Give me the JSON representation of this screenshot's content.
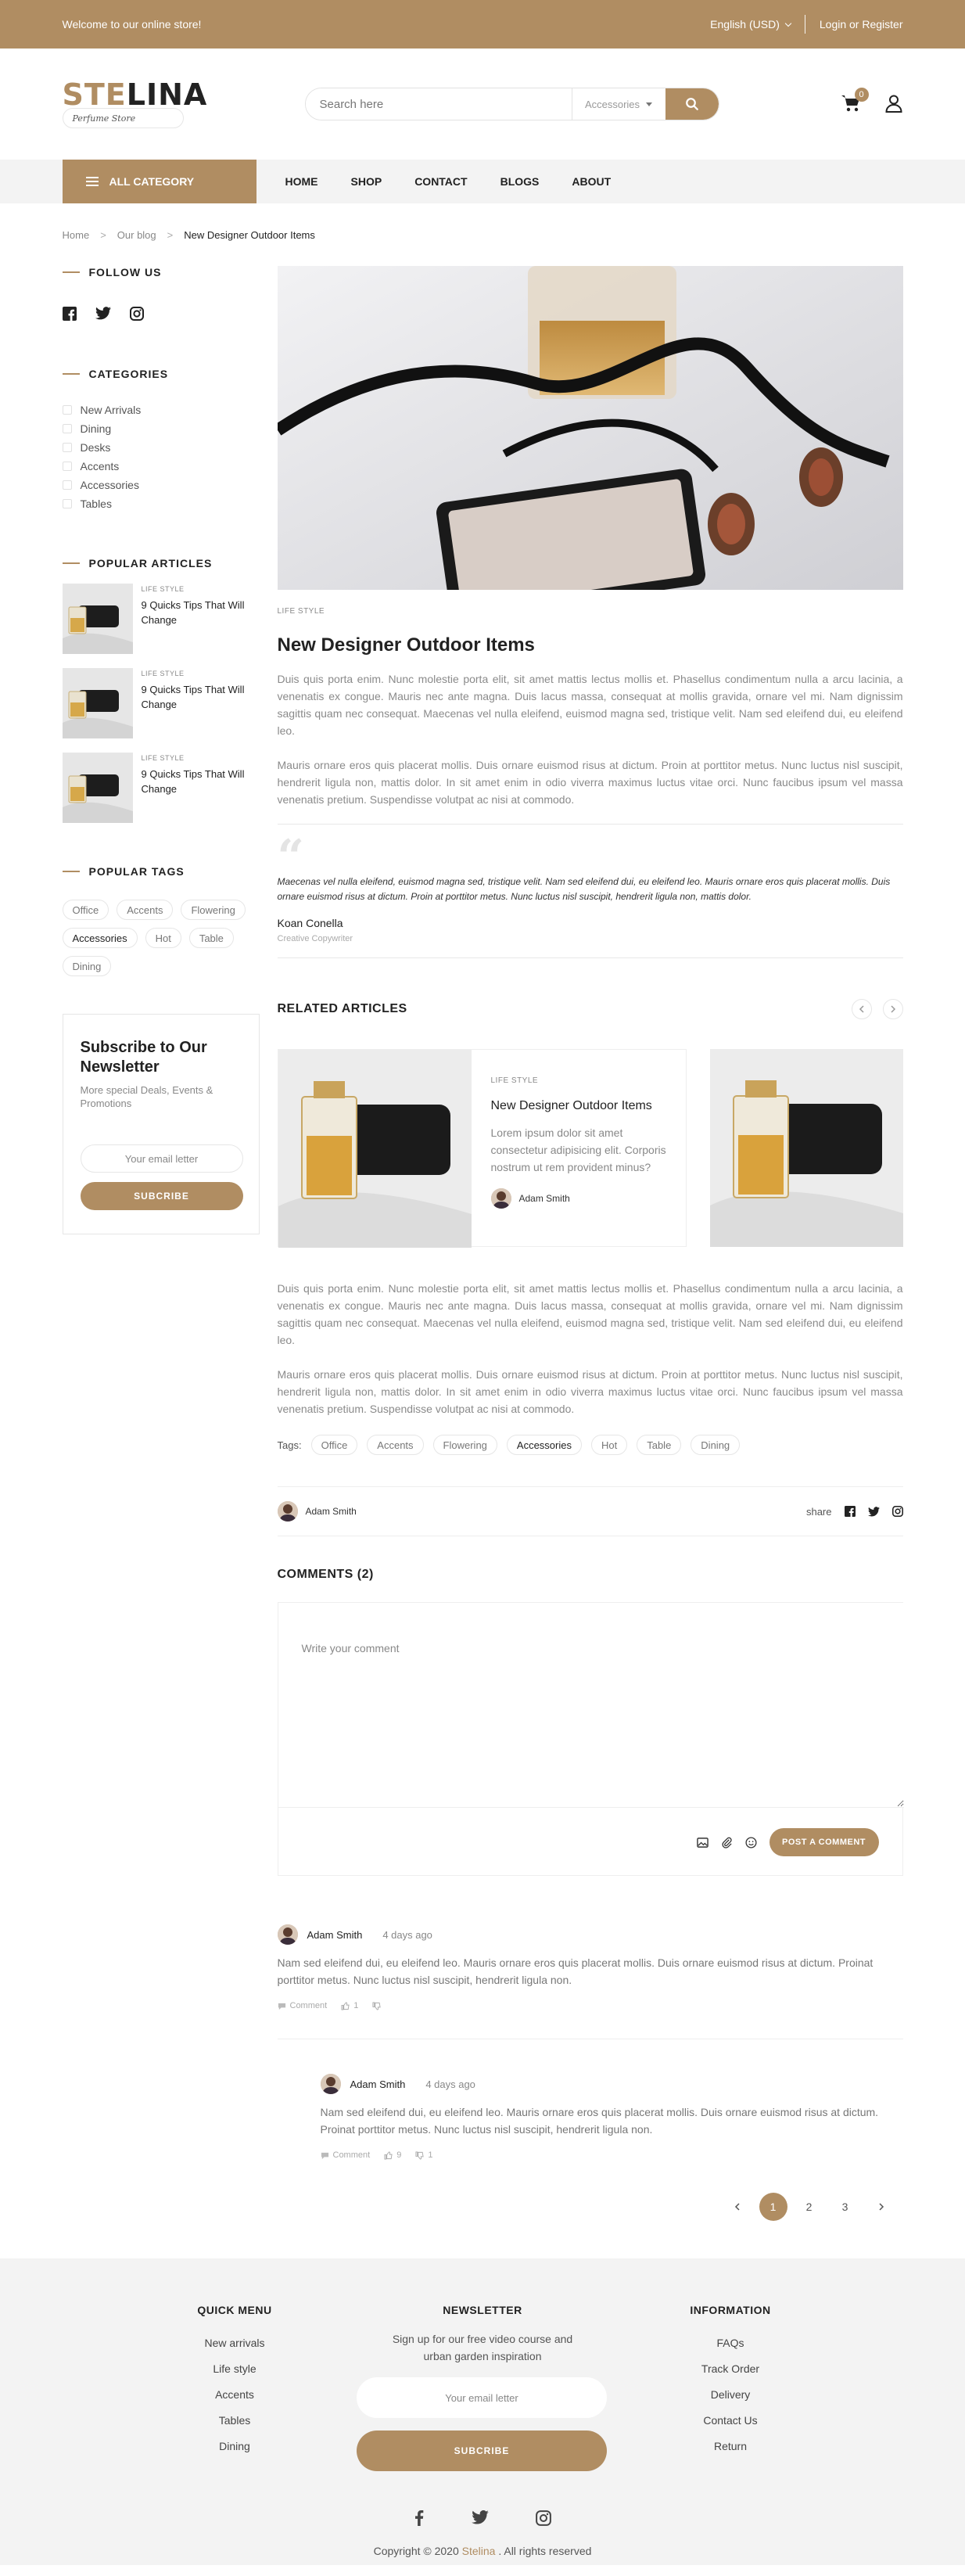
{
  "topbar": {
    "welcome": "Welcome to our online store!",
    "language": "English (USD)",
    "auth": "Login or Register"
  },
  "header": {
    "logo_part1": "STE",
    "logo_part2": "LINA",
    "logo_tagline": "Perfume Store",
    "search_placeholder": "Search here",
    "search_category": "Accessories",
    "cart_count": "0",
    "icons": [
      "search-icon",
      "cart-icon",
      "user-icon"
    ]
  },
  "nav": {
    "all_category": "ALL CATEGORY",
    "items": [
      "HOME",
      "SHOP",
      "CONTACT",
      "BLOGS",
      "ABOUT"
    ]
  },
  "breadcrumb": [
    "Home",
    "Our blog",
    "New Designer Outdoor Items"
  ],
  "sidebar": {
    "follow_title": "FOLLOW US",
    "social_icons": [
      "facebook-icon",
      "twitter-icon",
      "instagram-icon"
    ],
    "categories_title": "CATEGORIES",
    "categories": [
      "New Arrivals",
      "Dining",
      "Desks",
      "Accents",
      "Accessories",
      "Tables"
    ],
    "popular_title": "POPULAR ARTICLES",
    "popular": [
      {
        "kicker": "LIFE STYLE",
        "title": "9 Quicks Tips That Will Change"
      },
      {
        "kicker": "LIFE STYLE",
        "title": "9 Quicks Tips That Will Change"
      },
      {
        "kicker": "LIFE STYLE",
        "title": "9 Quicks Tips That Will Change"
      }
    ],
    "tags_title": "POPULAR TAGS",
    "tags": [
      "Office",
      "Accents",
      "Flowering",
      "Accessories",
      "Hot",
      "Table",
      "Dining"
    ],
    "newsletter": {
      "title": "Subscribe to Our Newsletter",
      "text": "More special Deals, Events & Promotions",
      "placeholder": "Your email letter",
      "button": "SUBCRIBE"
    }
  },
  "post": {
    "kicker": "LIFE STYLE",
    "title": "New Designer Outdoor Items",
    "para1": "Duis quis porta enim. Nunc molestie porta elit, sit amet mattis lectus mollis et. Phasellus condimentum nulla a arcu lacinia, a venenatis ex congue. Mauris nec ante magna. Duis lacus massa, consequat at mollis gravida, ornare vel mi. Nam dignissim sagittis quam nec consequat. Maecenas vel nulla eleifend, euismod magna sed, tristique velit. Nam sed eleifend dui, eu eleifend leo.",
    "para2": "Mauris ornare eros quis placerat mollis. Duis ornare euismod risus at dictum. Proin at porttitor metus. Nunc luctus nisl suscipit, hendrerit ligula non, mattis dolor. In sit amet enim in odio viverra maximus luctus vitae orci. Nunc faucibus ipsum vel massa venenatis pretium. Suspendisse volutpat ac nisi at commodo.",
    "quote": "Maecenas vel nulla eleifend, euismod magna sed, tristique velit. Nam sed eleifend dui, eu eleifend leo. Mauris ornare eros quis placerat mollis. Duis ornare euismod risus at dictum. Proin at porttitor metus. Nunc luctus nisl suscipit, hendrerit ligula non, mattis dolor.",
    "quote_author": "Koan Conella",
    "quote_role": "Creative Copywriter",
    "related_title": "RELATED ARTICLES",
    "related": {
      "kicker": "LIFE STYLE",
      "title": "New Designer Outdoor Items",
      "desc": "Lorem ipsum dolor sit amet consectetur adipisicing elit. Corporis nostrum ut rem provident minus?",
      "author": "Adam Smith"
    },
    "para3": "Duis quis porta enim. Nunc molestie porta elit, sit amet mattis lectus mollis et. Phasellus condimentum nulla a arcu lacinia, a venenatis ex congue. Mauris nec ante magna. Duis lacus massa, consequat at mollis gravida, ornare vel mi. Nam dignissim sagittis quam nec consequat. Maecenas vel nulla eleifend, euismod magna sed, tristique velit. Nam sed eleifend dui, eu eleifend leo.",
    "para4": "Mauris ornare eros quis placerat mollis. Duis ornare euismod risus at dictum. Proin at porttitor metus. Nunc luctus nisl suscipit, hendrerit ligula non, mattis dolor. In sit amet enim in odio viverra maximus luctus vitae orci. Nunc faucibus ipsum vel massa venenatis pretium. Suspendisse volutpat ac nisi at commodo.",
    "tags_label": "Tags:",
    "tags": [
      "Office",
      "Accents",
      "Flowering",
      "Accessories",
      "Hot",
      "Table",
      "Dining"
    ],
    "author": "Adam Smith",
    "share_label": "share"
  },
  "comments": {
    "title": "COMMENTS (2)",
    "placeholder": "Write your comment",
    "post_button": "POST A COMMENT",
    "items": [
      {
        "author": "Adam Smith",
        "date": "4 days ago",
        "body": "Nam sed eleifend dui, eu eleifend leo. Mauris ornare eros quis placerat mollis. Duis ornare euismod risus at dictum. Proinat porttitor metus. Nunc luctus nisl suscipit, hendrerit ligula non.",
        "comment_label": "Comment",
        "likes": "1",
        "dislikes": ""
      },
      {
        "author": "Adam Smith",
        "date": "4 days ago",
        "body": "Nam sed eleifend dui, eu eleifend leo. Mauris ornare eros quis placerat mollis. Duis ornare euismod risus at dictum. Proinat porttitor metus. Nunc luctus nisl suscipit, hendrerit ligula non.",
        "comment_label": "Comment",
        "likes": "9",
        "dislikes": "1"
      }
    ]
  },
  "pagination": {
    "pages": [
      "1",
      "2",
      "3"
    ],
    "active": "1"
  },
  "footer": {
    "quick_title": "QUICK MENU",
    "quick": [
      "New arrivals",
      "Life style",
      "Accents",
      "Tables",
      "Dining"
    ],
    "nl_title": "NEWSLETTER",
    "nl_text": "Sign up for our free video course and urban garden inspiration",
    "nl_placeholder": "Your email letter",
    "nl_button": "SUBCRIBE",
    "info_title": "INFORMATION",
    "info": [
      "FAQs",
      "Track Order",
      "Delivery",
      "Contact Us",
      "Return"
    ],
    "copy_pre": "Copyright © 2020",
    "copy_brand": "Stelina",
    "copy_post": ". All rights reserved"
  },
  "colors": {
    "accent": "#b08d62",
    "light_bg": "#f3f3f3"
  }
}
